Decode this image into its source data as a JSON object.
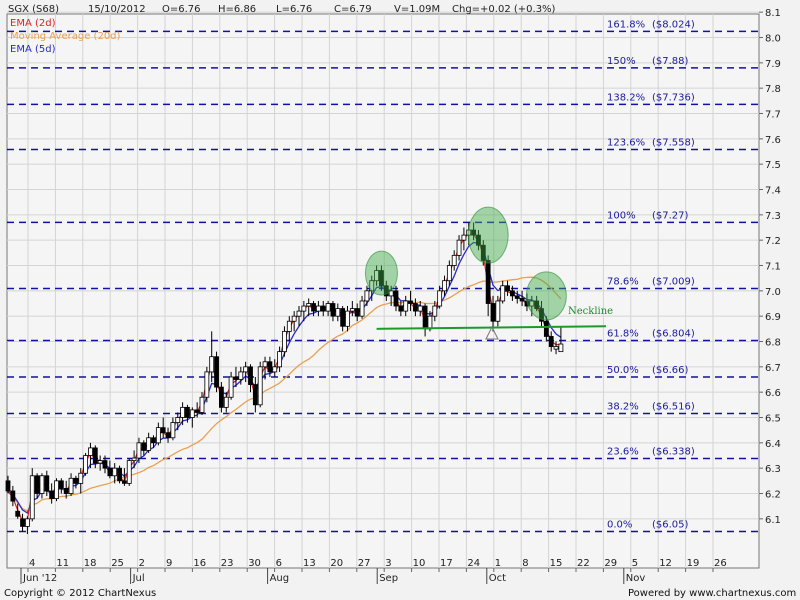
{
  "header": {
    "symbol": "SGX (S68)",
    "date": "15/10/2012",
    "open": "O=6.76",
    "high": "H=6.86",
    "low": "L=6.76",
    "close": "C=6.79",
    "volume": "V=1.09M",
    "change": "Chg=+0.02 (+0.3%)"
  },
  "legend": [
    {
      "label": "EMA (2d)",
      "color": "#dd2222"
    },
    {
      "label": "Moving Average (20d)",
      "color": "#e8a050"
    },
    {
      "label": "EMA (5d)",
      "color": "#2a2ac8"
    }
  ],
  "footer": {
    "copyright": "Copyright © 2012 ChartNexus",
    "powered": "Powered by www.chartnexus.com"
  },
  "chart_data": {
    "type": "candlestick",
    "ylim": [
      6.0,
      8.1
    ],
    "yticks": [
      "6.1",
      "6.2",
      "6.3",
      "6.4",
      "6.5",
      "6.6",
      "6.7",
      "6.8",
      "6.9",
      "7.0",
      "7.1",
      "7.2",
      "7.3",
      "7.4",
      "7.5",
      "7.6",
      "7.7",
      "7.8",
      "7.9",
      "8.0",
      "8.1"
    ],
    "xticks": [
      {
        "day": "4",
        "month": "Jun '12"
      },
      {
        "day": "11"
      },
      {
        "day": "18"
      },
      {
        "day": "25"
      },
      {
        "day": "2",
        "month": "Jul"
      },
      {
        "day": "9"
      },
      {
        "day": "16"
      },
      {
        "day": "23"
      },
      {
        "day": "30"
      },
      {
        "day": "6",
        "month": "Aug"
      },
      {
        "day": "13"
      },
      {
        "day": "20"
      },
      {
        "day": "27"
      },
      {
        "day": "3",
        "month": "Sep"
      },
      {
        "day": "10"
      },
      {
        "day": "17"
      },
      {
        "day": "24"
      },
      {
        "day": "1",
        "month": "Oct"
      },
      {
        "day": "8"
      },
      {
        "day": "15"
      },
      {
        "day": "22"
      },
      {
        "day": "29"
      },
      {
        "day": "5",
        "month": "Nov"
      },
      {
        "day": "12"
      },
      {
        "day": "19"
      },
      {
        "day": "26"
      }
    ],
    "fib_levels": [
      {
        "label": "161.8%",
        "price": "($8.024)",
        "value": 8.024
      },
      {
        "label": "150%",
        "price": "($7.88)",
        "value": 7.88
      },
      {
        "label": "138.2%",
        "price": "($7.736)",
        "value": 7.736
      },
      {
        "label": "123.6%",
        "price": "($7.558)",
        "value": 7.558
      },
      {
        "label": "100%",
        "price": "($7.27)",
        "value": 7.27
      },
      {
        "label": "78.6%",
        "price": "($7.009)",
        "value": 7.009
      },
      {
        "label": "61.8%",
        "price": "($6.804)",
        "value": 6.804
      },
      {
        "label": "50.0%",
        "price": "($6.66)",
        "value": 6.66
      },
      {
        "label": "38.2%",
        "price": "($6.516)",
        "value": 6.516
      },
      {
        "label": "23.6%",
        "price": "($6.338)",
        "value": 6.338
      },
      {
        "label": "0.0%",
        "price": "($6.05)",
        "value": 6.05
      }
    ],
    "neckline": {
      "label": "Neckline",
      "start_index": 76,
      "end_index": 120,
      "start_value": 6.85,
      "end_value": 6.86
    },
    "highlight_circles": [
      {
        "index": 77,
        "value": 7.07
      },
      {
        "index": 99,
        "value": 7.22
      },
      {
        "index": 111,
        "value": 6.98
      }
    ],
    "candles": [
      {
        "o": 6.25,
        "h": 6.27,
        "l": 6.2,
        "c": 6.21
      },
      {
        "o": 6.21,
        "h": 6.23,
        "l": 6.15,
        "c": 6.17
      },
      {
        "o": 6.13,
        "h": 6.16,
        "l": 6.1,
        "c": 6.11
      },
      {
        "o": 6.1,
        "h": 6.12,
        "l": 6.05,
        "c": 6.07
      },
      {
        "o": 6.07,
        "h": 6.11,
        "l": 6.04,
        "c": 6.1
      },
      {
        "o": 6.1,
        "h": 6.3,
        "l": 6.09,
        "c": 6.27
      },
      {
        "o": 6.27,
        "h": 6.28,
        "l": 6.18,
        "c": 6.2
      },
      {
        "o": 6.2,
        "h": 6.28,
        "l": 6.18,
        "c": 6.27
      },
      {
        "o": 6.27,
        "h": 6.29,
        "l": 6.19,
        "c": 6.21
      },
      {
        "o": 6.21,
        "h": 6.24,
        "l": 6.16,
        "c": 6.18
      },
      {
        "o": 6.18,
        "h": 6.26,
        "l": 6.17,
        "c": 6.25
      },
      {
        "o": 6.25,
        "h": 6.26,
        "l": 6.2,
        "c": 6.22
      },
      {
        "o": 6.22,
        "h": 6.25,
        "l": 6.18,
        "c": 6.2
      },
      {
        "o": 6.2,
        "h": 6.28,
        "l": 6.19,
        "c": 6.26
      },
      {
        "o": 6.26,
        "h": 6.27,
        "l": 6.22,
        "c": 6.24
      },
      {
        "o": 6.24,
        "h": 6.3,
        "l": 6.2,
        "c": 6.28
      },
      {
        "o": 6.28,
        "h": 6.36,
        "l": 6.27,
        "c": 6.35
      },
      {
        "o": 6.35,
        "h": 6.4,
        "l": 6.3,
        "c": 6.38
      },
      {
        "o": 6.38,
        "h": 6.39,
        "l": 6.3,
        "c": 6.32
      },
      {
        "o": 6.32,
        "h": 6.35,
        "l": 6.29,
        "c": 6.33
      },
      {
        "o": 6.33,
        "h": 6.35,
        "l": 6.28,
        "c": 6.3
      },
      {
        "o": 6.3,
        "h": 6.33,
        "l": 6.26,
        "c": 6.27
      },
      {
        "o": 6.27,
        "h": 6.32,
        "l": 6.24,
        "c": 6.3
      },
      {
        "o": 6.3,
        "h": 6.31,
        "l": 6.24,
        "c": 6.25
      },
      {
        "o": 6.25,
        "h": 6.3,
        "l": 6.23,
        "c": 6.24
      },
      {
        "o": 6.24,
        "h": 6.34,
        "l": 6.23,
        "c": 6.33
      },
      {
        "o": 6.33,
        "h": 6.37,
        "l": 6.3,
        "c": 6.34
      },
      {
        "o": 6.34,
        "h": 6.42,
        "l": 6.32,
        "c": 6.4
      },
      {
        "o": 6.4,
        "h": 6.41,
        "l": 6.35,
        "c": 6.37
      },
      {
        "o": 6.37,
        "h": 6.44,
        "l": 6.36,
        "c": 6.42
      },
      {
        "o": 6.42,
        "h": 6.43,
        "l": 6.38,
        "c": 6.4
      },
      {
        "o": 6.4,
        "h": 6.48,
        "l": 6.39,
        "c": 6.46
      },
      {
        "o": 6.46,
        "h": 6.5,
        "l": 6.42,
        "c": 6.44
      },
      {
        "o": 6.44,
        "h": 6.46,
        "l": 6.4,
        "c": 6.42
      },
      {
        "o": 6.42,
        "h": 6.5,
        "l": 6.41,
        "c": 6.48
      },
      {
        "o": 6.48,
        "h": 6.52,
        "l": 6.45,
        "c": 6.5
      },
      {
        "o": 6.5,
        "h": 6.56,
        "l": 6.47,
        "c": 6.54
      },
      {
        "o": 6.54,
        "h": 6.55,
        "l": 6.48,
        "c": 6.5
      },
      {
        "o": 6.5,
        "h": 6.54,
        "l": 6.46,
        "c": 6.53
      },
      {
        "o": 6.53,
        "h": 6.56,
        "l": 6.5,
        "c": 6.52
      },
      {
        "o": 6.52,
        "h": 6.6,
        "l": 6.51,
        "c": 6.58
      },
      {
        "o": 6.58,
        "h": 6.7,
        "l": 6.56,
        "c": 6.68
      },
      {
        "o": 6.68,
        "h": 6.84,
        "l": 6.64,
        "c": 6.74
      },
      {
        "o": 6.74,
        "h": 6.76,
        "l": 6.6,
        "c": 6.62
      },
      {
        "o": 6.62,
        "h": 6.64,
        "l": 6.52,
        "c": 6.54
      },
      {
        "o": 6.54,
        "h": 6.6,
        "l": 6.52,
        "c": 6.58
      },
      {
        "o": 6.58,
        "h": 6.68,
        "l": 6.57,
        "c": 6.66
      },
      {
        "o": 6.66,
        "h": 6.7,
        "l": 6.62,
        "c": 6.65
      },
      {
        "o": 6.65,
        "h": 6.7,
        "l": 6.63,
        "c": 6.68
      },
      {
        "o": 6.68,
        "h": 6.72,
        "l": 6.64,
        "c": 6.7
      },
      {
        "o": 6.7,
        "h": 6.71,
        "l": 6.6,
        "c": 6.63
      },
      {
        "o": 6.63,
        "h": 6.66,
        "l": 6.52,
        "c": 6.55
      },
      {
        "o": 6.55,
        "h": 6.72,
        "l": 6.54,
        "c": 6.7
      },
      {
        "o": 6.7,
        "h": 6.74,
        "l": 6.65,
        "c": 6.72
      },
      {
        "o": 6.72,
        "h": 6.74,
        "l": 6.66,
        "c": 6.68
      },
      {
        "o": 6.68,
        "h": 6.73,
        "l": 6.66,
        "c": 6.7
      },
      {
        "o": 6.7,
        "h": 6.78,
        "l": 6.68,
        "c": 6.76
      },
      {
        "o": 6.76,
        "h": 6.86,
        "l": 6.74,
        "c": 6.84
      },
      {
        "o": 6.84,
        "h": 6.9,
        "l": 6.8,
        "c": 6.88
      },
      {
        "o": 6.88,
        "h": 6.92,
        "l": 6.84,
        "c": 6.9
      },
      {
        "o": 6.9,
        "h": 6.94,
        "l": 6.86,
        "c": 6.92
      },
      {
        "o": 6.92,
        "h": 6.96,
        "l": 6.88,
        "c": 6.94
      },
      {
        "o": 6.94,
        "h": 6.97,
        "l": 6.9,
        "c": 6.95
      },
      {
        "o": 6.95,
        "h": 6.96,
        "l": 6.9,
        "c": 6.92
      },
      {
        "o": 6.92,
        "h": 6.96,
        "l": 6.9,
        "c": 6.94
      },
      {
        "o": 6.94,
        "h": 6.96,
        "l": 6.9,
        "c": 6.92
      },
      {
        "o": 6.92,
        "h": 6.96,
        "l": 6.9,
        "c": 6.95
      },
      {
        "o": 6.95,
        "h": 6.96,
        "l": 6.88,
        "c": 6.9
      },
      {
        "o": 6.9,
        "h": 6.95,
        "l": 6.88,
        "c": 6.93
      },
      {
        "o": 6.93,
        "h": 6.94,
        "l": 6.84,
        "c": 6.86
      },
      {
        "o": 6.86,
        "h": 6.94,
        "l": 6.84,
        "c": 6.92
      },
      {
        "o": 6.92,
        "h": 6.96,
        "l": 6.9,
        "c": 6.93
      },
      {
        "o": 6.93,
        "h": 6.95,
        "l": 6.88,
        "c": 6.9
      },
      {
        "o": 6.9,
        "h": 6.98,
        "l": 6.89,
        "c": 6.96
      },
      {
        "o": 6.96,
        "h": 7.02,
        "l": 6.94,
        "c": 7.0
      },
      {
        "o": 7.0,
        "h": 7.06,
        "l": 6.96,
        "c": 7.04
      },
      {
        "o": 7.04,
        "h": 7.1,
        "l": 7.02,
        "c": 7.08
      },
      {
        "o": 7.08,
        "h": 7.1,
        "l": 7.0,
        "c": 7.02
      },
      {
        "o": 7.02,
        "h": 7.04,
        "l": 6.96,
        "c": 6.98
      },
      {
        "o": 6.98,
        "h": 7.02,
        "l": 6.94,
        "c": 7.0
      },
      {
        "o": 7.0,
        "h": 7.02,
        "l": 6.92,
        "c": 6.94
      },
      {
        "o": 6.94,
        "h": 6.96,
        "l": 6.9,
        "c": 6.92
      },
      {
        "o": 6.92,
        "h": 6.98,
        "l": 6.9,
        "c": 6.96
      },
      {
        "o": 6.96,
        "h": 7.0,
        "l": 6.92,
        "c": 6.95
      },
      {
        "o": 6.95,
        "h": 6.97,
        "l": 6.9,
        "c": 6.92
      },
      {
        "o": 6.92,
        "h": 6.96,
        "l": 6.9,
        "c": 6.94
      },
      {
        "o": 6.94,
        "h": 6.95,
        "l": 6.82,
        "c": 6.85
      },
      {
        "o": 6.85,
        "h": 6.92,
        "l": 6.84,
        "c": 6.9
      },
      {
        "o": 6.9,
        "h": 6.96,
        "l": 6.88,
        "c": 6.94
      },
      {
        "o": 6.94,
        "h": 7.02,
        "l": 6.93,
        "c": 7.0
      },
      {
        "o": 7.0,
        "h": 7.06,
        "l": 6.98,
        "c": 7.04
      },
      {
        "o": 7.04,
        "h": 7.12,
        "l": 7.02,
        "c": 7.1
      },
      {
        "o": 7.1,
        "h": 7.16,
        "l": 7.08,
        "c": 7.14
      },
      {
        "o": 7.14,
        "h": 7.22,
        "l": 7.12,
        "c": 7.2
      },
      {
        "o": 7.2,
        "h": 7.25,
        "l": 7.16,
        "c": 7.22
      },
      {
        "o": 7.22,
        "h": 7.27,
        "l": 7.18,
        "c": 7.24
      },
      {
        "o": 7.24,
        "h": 7.27,
        "l": 7.2,
        "c": 7.22
      },
      {
        "o": 7.22,
        "h": 7.24,
        "l": 7.16,
        "c": 7.18
      },
      {
        "o": 7.18,
        "h": 7.2,
        "l": 7.1,
        "c": 7.12
      },
      {
        "o": 7.12,
        "h": 7.14,
        "l": 6.9,
        "c": 6.95
      },
      {
        "o": 6.95,
        "h": 6.98,
        "l": 6.84,
        "c": 6.88
      },
      {
        "o": 6.88,
        "h": 6.98,
        "l": 6.86,
        "c": 6.96
      },
      {
        "o": 6.96,
        "h": 7.04,
        "l": 6.95,
        "c": 7.02
      },
      {
        "o": 7.02,
        "h": 7.04,
        "l": 6.98,
        "c": 7.0
      },
      {
        "o": 7.0,
        "h": 7.02,
        "l": 6.96,
        "c": 6.98
      },
      {
        "o": 6.98,
        "h": 7.0,
        "l": 6.95,
        "c": 6.97
      },
      {
        "o": 6.97,
        "h": 7.0,
        "l": 6.94,
        "c": 6.96
      },
      {
        "o": 6.96,
        "h": 6.99,
        "l": 6.92,
        "c": 6.94
      },
      {
        "o": 6.94,
        "h": 6.98,
        "l": 6.9,
        "c": 6.96
      },
      {
        "o": 6.96,
        "h": 6.98,
        "l": 6.92,
        "c": 6.93
      },
      {
        "o": 6.93,
        "h": 6.96,
        "l": 6.86,
        "c": 6.88
      },
      {
        "o": 6.88,
        "h": 6.9,
        "l": 6.8,
        "c": 6.82
      },
      {
        "o": 6.82,
        "h": 6.84,
        "l": 6.76,
        "c": 6.78
      },
      {
        "o": 6.77,
        "h": 6.8,
        "l": 6.75,
        "c": 6.78
      },
      {
        "o": 6.76,
        "h": 6.86,
        "l": 6.76,
        "c": 6.79
      }
    ]
  }
}
